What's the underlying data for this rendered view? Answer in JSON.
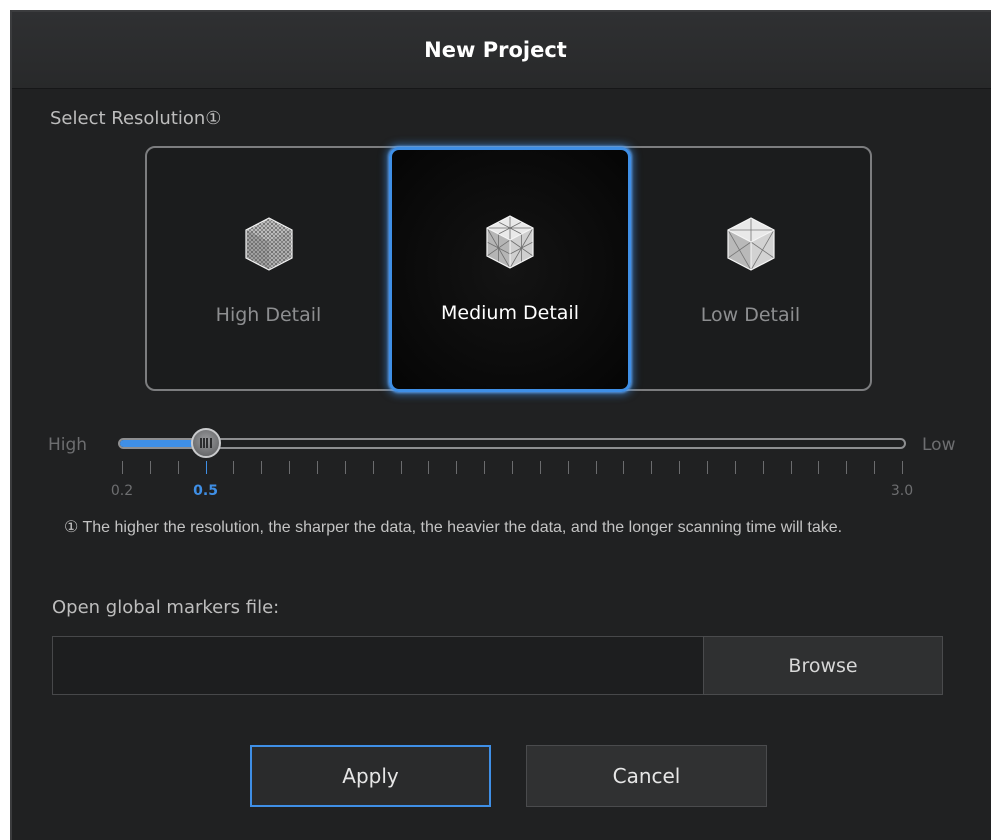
{
  "dialog": {
    "title": "New Project"
  },
  "resolution": {
    "section_label": "Select Resolution①",
    "options": [
      {
        "label": "High Detail",
        "icon": "dense-mesh-cube-icon",
        "selected": false
      },
      {
        "label": "Medium Detail",
        "icon": "medium-mesh-cube-icon",
        "selected": true
      },
      {
        "label": "Low Detail",
        "icon": "sparse-mesh-cube-icon",
        "selected": false
      }
    ]
  },
  "slider": {
    "left_label": "High",
    "right_label": "Low",
    "min": 0.2,
    "max": 3.0,
    "value": 0.5,
    "min_label": "0.2",
    "value_label": "0.5",
    "max_label": "3.0",
    "accent_color": "#3f8fe6"
  },
  "note": {
    "text": "① The higher the resolution, the sharper the data, the heavier the data, and the longer scanning time will take."
  },
  "global_markers": {
    "label": "Open global markers file:",
    "value": "",
    "browse_label": "Browse"
  },
  "actions": {
    "apply_label": "Apply",
    "cancel_label": "Cancel"
  }
}
